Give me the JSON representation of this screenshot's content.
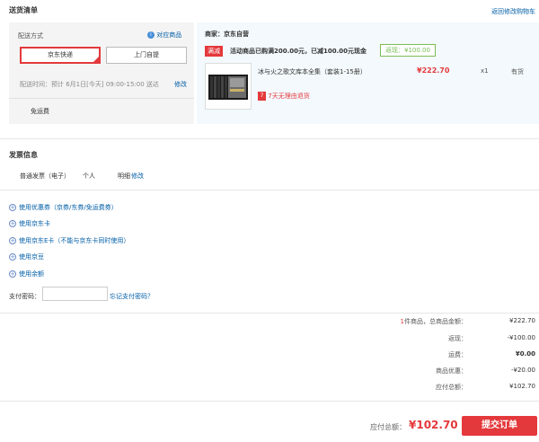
{
  "header": {
    "title": "送货清单",
    "back_link": "返回修改购物车"
  },
  "delivery": {
    "label": "配送方式",
    "supported_items_link": "对应商品",
    "options": [
      "京东快递",
      "上门自提"
    ],
    "time_label": "配送时间：",
    "time_value": "预计 6月1日[今天] 09:00-15:00 送达",
    "modify": "修改",
    "shipping_fee": "免运费"
  },
  "merchant": {
    "label": "商家：京东自营",
    "promo_badge": "满减",
    "promo_text": "活动商品已购满200.00元，已减100.00元现金",
    "rebate_label": "返现：¥100.00",
    "product_name": "冰与火之歌文库本全集（套装1-15册）",
    "price": "¥222.70",
    "qty": "x1",
    "stock": "有货",
    "return_badge": "7",
    "return_text": "7天无理由退货"
  },
  "invoice": {
    "title": "发票信息",
    "type": "普通发票（电子）",
    "person": "个人",
    "detail": "明细",
    "modify": "修改"
  },
  "options": [
    "使用优惠券（京券/东券/免运费券）",
    "使用京东卡",
    "使用京东E卡（不能与京东卡同时使用）",
    "使用京豆",
    "使用余额"
  ],
  "paypass": {
    "label": "支付密码：",
    "value": "",
    "forgot": "忘记支付密码？"
  },
  "summary": {
    "count_prefix": "1",
    "count_suffix": "件商品，总商品金额：",
    "total_goods": "¥222.70",
    "rebate_label": "返现：",
    "rebate_value": "-¥100.00",
    "freight_label": "运费：",
    "freight_value": "¥0.00",
    "discount_label": "商品优惠：",
    "discount_value": "-¥20.00",
    "payable_label": "应付总额：",
    "payable_value": "¥102.70"
  },
  "footer": {
    "payable_label": "应付总额：",
    "payable_value": "¥102.70",
    "submit": "提交订单"
  },
  "colors": {
    "accent_red": "#e4393c",
    "link_blue": "#005ea7",
    "panel_bg": "#f4f4f4",
    "merchant_bg": "#f3f9fd"
  }
}
